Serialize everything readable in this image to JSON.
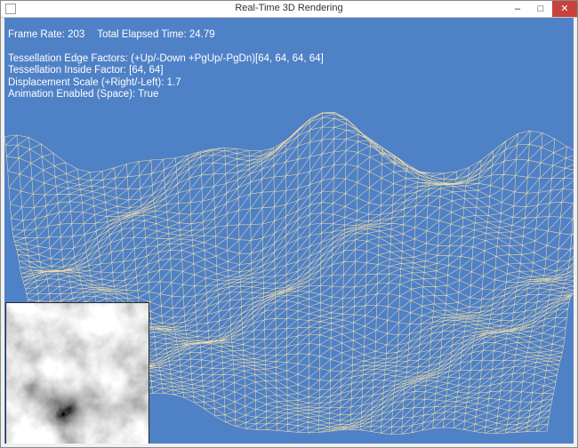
{
  "window": {
    "title": "Real-Time 3D Rendering",
    "buttons": {
      "minimize": "–",
      "maximize": "□",
      "close": "✕"
    }
  },
  "hud": {
    "frame_rate": "Frame Rate: 203",
    "elapsed_time": "Total Elapsed Time: 24.79",
    "edge_factors": "Tessellation Edge Factors: (+Up/-Down +PgUp/-PgDn)[64, 64, 64, 64]",
    "inside_factor": "Tessellation Inside Factor: [64, 64]",
    "displacement_scale": "Displacement Scale (+Right/-Left): 1.7",
    "animation_enabled": "Animation Enabled (Space): True"
  },
  "colors": {
    "background": "#4f81c7",
    "mesh": "#f5dfa6",
    "text": "#ffffff"
  },
  "icons": {
    "app": "app-window-icon",
    "minimize": "minimize-icon",
    "maximize": "maximize-icon",
    "close": "close-icon"
  }
}
